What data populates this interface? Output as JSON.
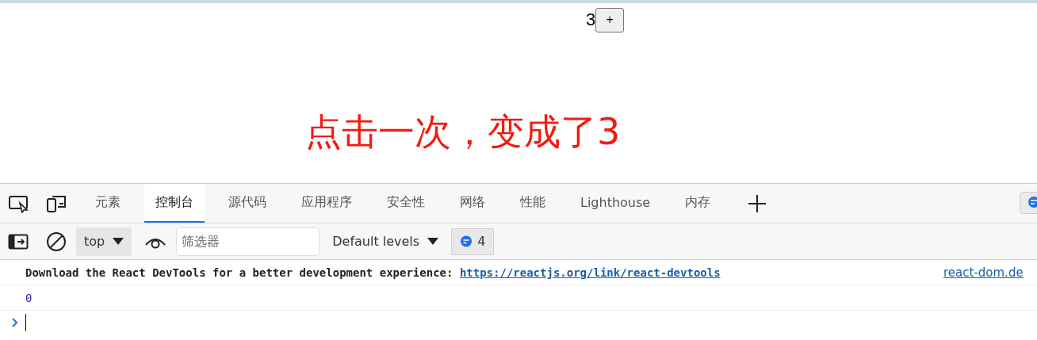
{
  "page": {
    "count": "3",
    "increment_button": "+",
    "annotation": "点击一次，变成了3"
  },
  "devtools": {
    "tabs": [
      {
        "label": "元素",
        "selected": false
      },
      {
        "label": "控制台",
        "selected": true
      },
      {
        "label": "源代码",
        "selected": false
      },
      {
        "label": "应用程序",
        "selected": false
      },
      {
        "label": "安全性",
        "selected": false
      },
      {
        "label": "网络",
        "selected": false
      },
      {
        "label": "性能",
        "selected": false
      },
      {
        "label": "Lighthouse",
        "selected": false
      },
      {
        "label": "内存",
        "selected": false
      }
    ],
    "toolbar": {
      "context": "top",
      "filter": {
        "placeholder": "筛选器"
      },
      "levels": "Default levels",
      "message_count": "4"
    },
    "console": {
      "messages": [
        {
          "kind": "log",
          "text": "Download the React DevTools for a better development experience: ",
          "link": "https://reactjs.org/link/react-devtools",
          "source": "react-dom.de"
        },
        {
          "kind": "value",
          "text": "0"
        }
      ]
    }
  }
}
